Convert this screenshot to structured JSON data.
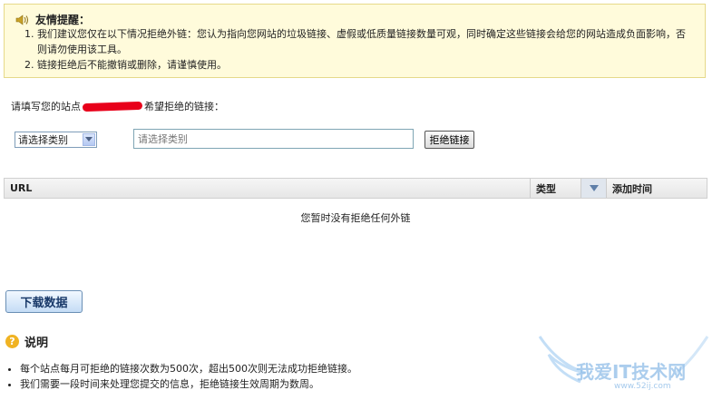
{
  "notice": {
    "title": "友情提醒：",
    "items": [
      "我们建议您仅在以下情况拒绝外链：您认为指向您网站的垃圾链接、虚假或低质量链接数量可观，同时确定这些链接会给您的网站造成负面影响，否则请勿使用该工具。",
      "链接拒绝后不能撤销或删除，请谨慎使用。"
    ]
  },
  "form": {
    "prompt_before": "请填写您的站点",
    "prompt_after": "希望拒绝的链接：",
    "category_selected": "请选择类别",
    "url_placeholder": "请选择类别",
    "reject_label": "拒绝链接"
  },
  "table": {
    "col_url": "URL",
    "col_type": "类型",
    "col_time": "添加时间",
    "empty_text": "您暂时没有拒绝任何外链"
  },
  "download_label": "下载数据",
  "explain": {
    "title": "说明",
    "items": [
      "每个站点每月可拒绝的链接次数为500次，超出500次则无法成功拒绝链接。",
      "我们需要一段时间来处理您提交的信息，拒绝链接生效周期为数周。"
    ]
  },
  "watermark": {
    "text": "我爱IT技术网",
    "url": "www.52ij.com"
  },
  "colors": {
    "notice_bg": "#fffbdb",
    "redaction": "#e8001a",
    "button_text": "#1a3a6a"
  }
}
